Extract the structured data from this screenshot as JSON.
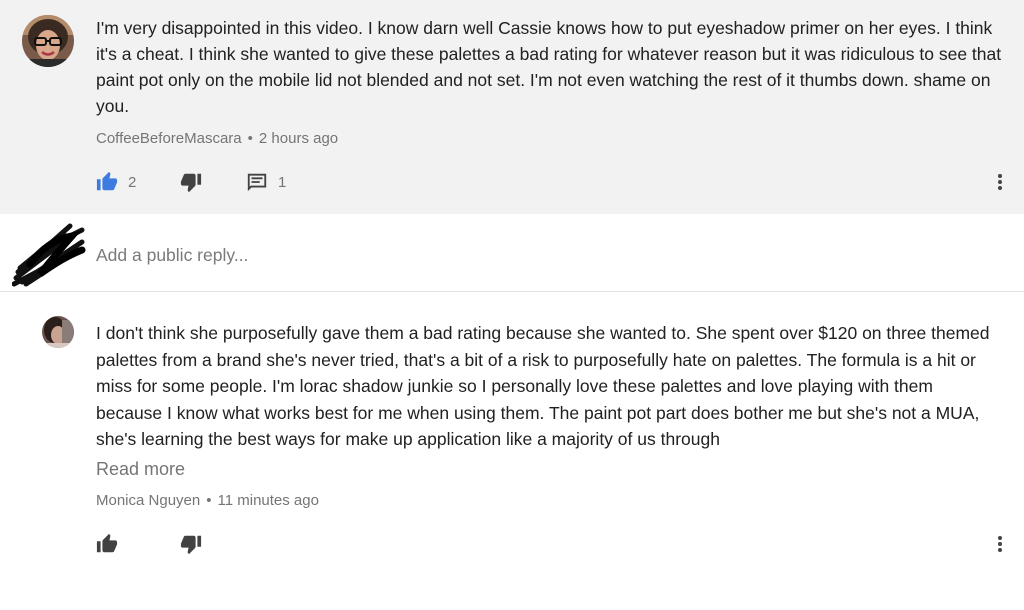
{
  "comment": {
    "text": "I'm very disappointed in this video. I know darn well Cassie knows how to put eyeshadow primer on her eyes. I think it's a cheat.   I think she wanted to give these palettes a bad rating for whatever reason but it was ridiculous to see that paint pot only on the mobile lid not blended and not set.   I'm not even watching the rest of it thumbs down.  shame on you.",
    "author": "CoffeeBeforeMascara",
    "separator": "•",
    "time": "2 hours ago",
    "like_count": "2",
    "reply_count": "1",
    "like_icon_color": "#3e7bde"
  },
  "reply_box": {
    "placeholder": "Add a public reply..."
  },
  "reply": {
    "text": "I don't think she purposefully gave them a bad rating because she wanted to. She spent over $120 on three themed palettes from a brand she's never tried, that's a bit of  a risk to purposefully hate on palettes. The formula is a hit or miss for some people. I'm lorac shadow junkie so I personally love these palettes and love playing with them because I know what works best for me when using them. The paint pot part does bother me but she's not a MUA, she's learning the best ways for make up application like a majority of us through",
    "read_more": "Read more",
    "author": "Monica Nguyen",
    "separator": "•",
    "time": "11 minutes ago"
  }
}
